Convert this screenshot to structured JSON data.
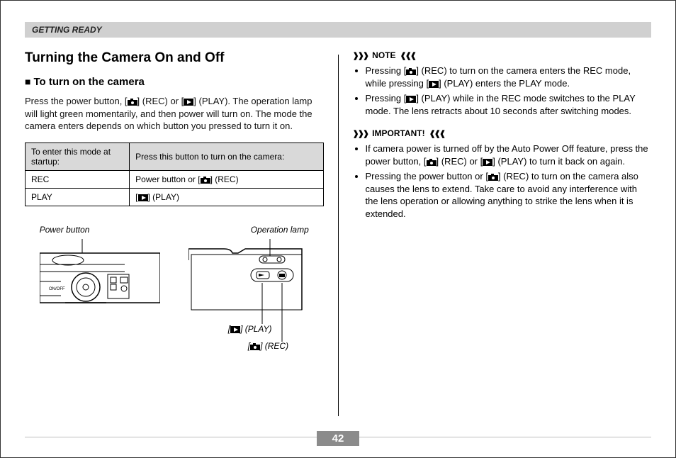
{
  "header": {
    "section": "GETTING READY"
  },
  "left": {
    "title": "Turning the Camera On and Off",
    "sub_title": "To turn on the camera",
    "intro_a": "Press the power button, [",
    "intro_b": "] (REC) or [",
    "intro_c": "] (PLAY). The operation lamp will light green momentarily, and then power will turn on. The mode the camera enters depends on which button you pressed to turn it on.",
    "table": {
      "head1": "To enter this mode at startup:",
      "head2": "Press this button to turn on the camera:",
      "rows": [
        {
          "mode": "REC",
          "btn_a": "Power button or [",
          "btn_b": "] (REC)"
        },
        {
          "mode": "PLAY",
          "btn_a": "[",
          "btn_b": "] (PLAY)"
        }
      ]
    },
    "diag": {
      "power_label": "Power button",
      "op_label": "Operation lamp",
      "play_callout_a": "[",
      "play_callout_b": "] (PLAY)",
      "rec_callout_a": "[",
      "rec_callout_b": "] (REC)",
      "onoff": "ON/OFF"
    }
  },
  "right": {
    "note_label": "NOTE",
    "note_items": [
      {
        "a": "Pressing [",
        "b": "] (REC) to turn on the camera enters the REC mode, while pressing [",
        "c": "] (PLAY) enters the PLAY mode."
      },
      {
        "a": "Pressing [",
        "b": "] (PLAY) while in the REC mode switches to the PLAY mode. The lens retracts about 10 seconds after switching modes."
      }
    ],
    "important_label": "IMPORTANT!",
    "important_items": [
      {
        "a": "If camera power is turned off by the Auto Power Off feature, press the power button, [",
        "b": "] (REC) or [",
        "c": "] (PLAY) to turn it back on again."
      },
      {
        "a": "Pressing the power button or [",
        "b": "] (REC) to turn on the camera also causes the lens to extend. Take care to avoid any interference with the lens operation or allowing anything to strike the lens when it is extended."
      }
    ]
  },
  "page": "42",
  "icons": {
    "camera": "camera-icon",
    "play": "play-icon"
  }
}
